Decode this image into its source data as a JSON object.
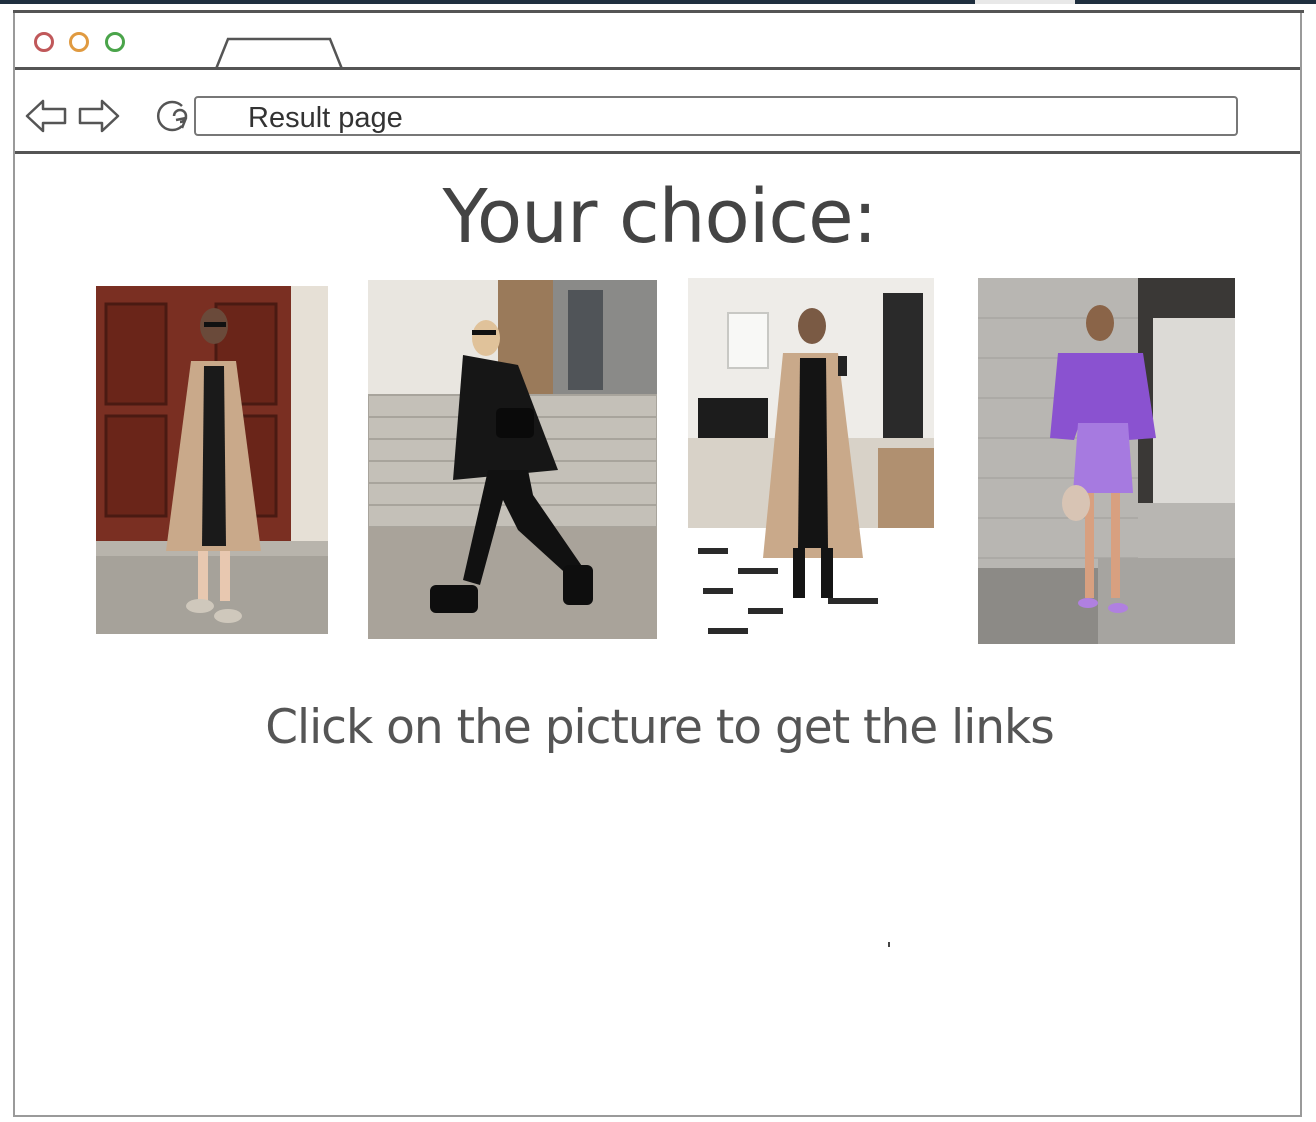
{
  "window": {
    "controls": [
      "close-button",
      "minimize-button",
      "maximize-button"
    ],
    "colors": {
      "close": "#c0585a",
      "minimize": "#e09a40",
      "maximize": "#4aa44a"
    }
  },
  "addressbar": {
    "url_text": "Result page"
  },
  "page": {
    "heading": "Your choice:",
    "instruction": "Click on the picture to get the links",
    "photos": [
      {
        "name": "photo-beige-trench-coat",
        "icon": "photo"
      },
      {
        "name": "photo-black-coat-boots",
        "icon": "photo"
      },
      {
        "name": "photo-trench-mirror-selfie",
        "icon": "photo"
      },
      {
        "name": "photo-purple-sweater-skirt",
        "icon": "photo"
      }
    ]
  }
}
